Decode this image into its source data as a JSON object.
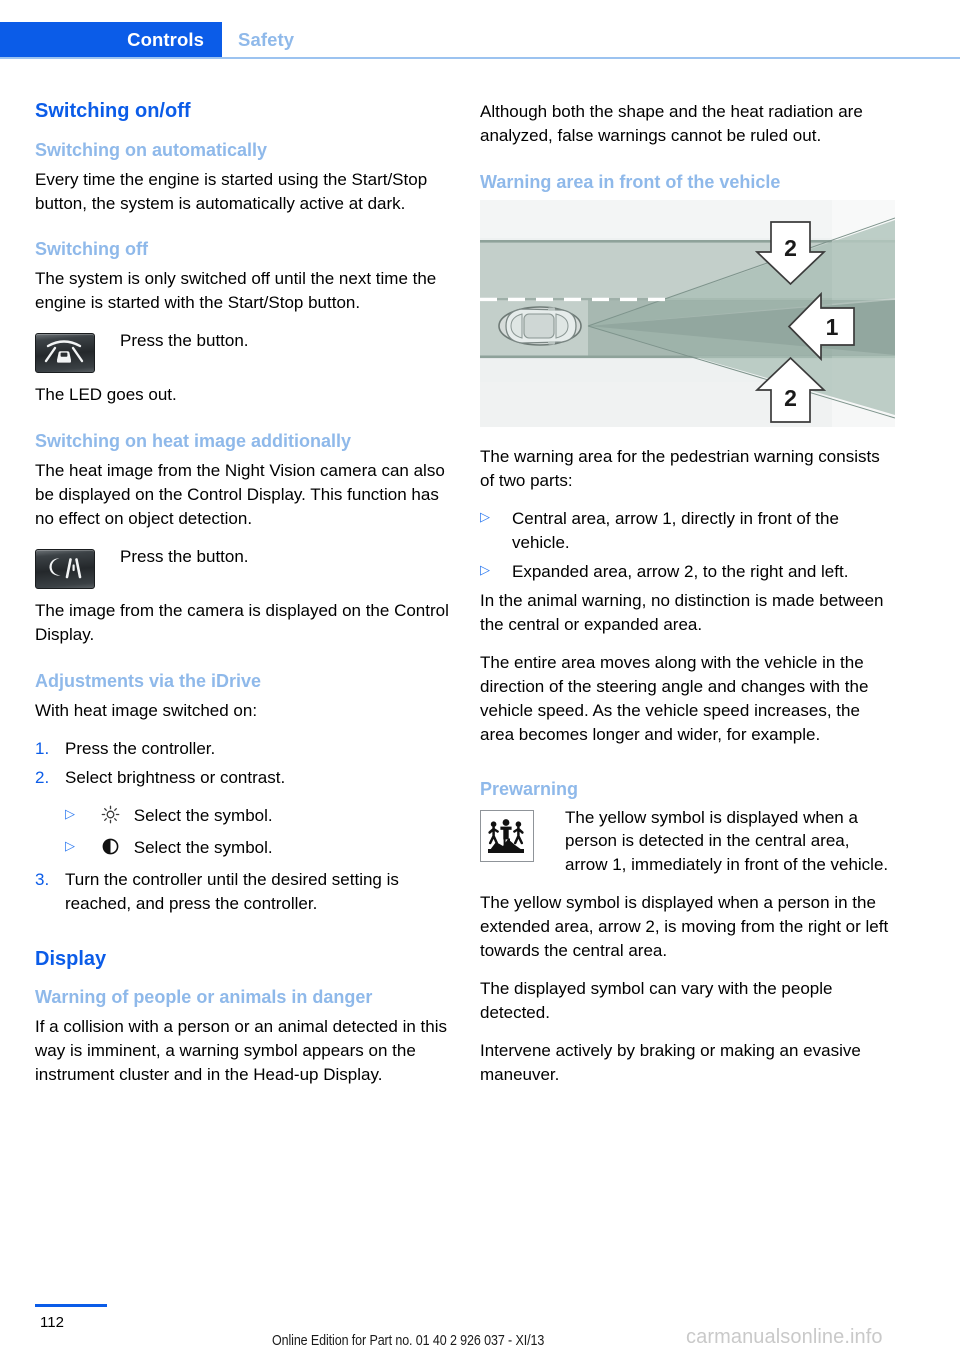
{
  "header": {
    "active_tab": "Controls",
    "inactive_tab": "Safety",
    "accent_color": "#0b5ce8",
    "muted_accent_color": "#8fb9ea"
  },
  "left_column": {
    "section_title": "Switching on/off",
    "sub_auto": "Switching on automatically",
    "p_auto": "Every time the engine is started using the Start/Stop button, the system is automatically active at dark.",
    "sub_off": "Switching off",
    "p_off": "The system is only switched off until the next time the engine is started with the Start/Stop button.",
    "press_button_1": "Press the button.",
    "p_led": "The LED goes out.",
    "sub_heat": "Switching on heat image additionally",
    "p_heat": "The heat image from the Night Vision camera can also be displayed on the Control Display. This function has no effect on object detection.",
    "press_button_2": "Press the button.",
    "p_camera": "The image from the camera is displayed on the Control Display.",
    "sub_idrive": "Adjustments via the iDrive",
    "p_idrive_intro": "With heat image switched on:",
    "steps": [
      {
        "num": "1.",
        "text": "Press the controller."
      },
      {
        "num": "2.",
        "text": "Select brightness or contrast."
      },
      {
        "num": "3.",
        "text": "Turn the controller until the desired setting is reached, and press the controller."
      }
    ],
    "sub_steps": [
      {
        "marker": "▷",
        "symbol": "brightness-icon",
        "text": "Select the symbol."
      },
      {
        "marker": "▷",
        "symbol": "contrast-icon",
        "text": "Select the symbol."
      }
    ],
    "section_title_2": "Display",
    "sub_warning": "Warning of people or animals in danger",
    "p_warning": "If a collision with a person or an animal detected in this way is imminent, a warning symbol appears on the instrument cluster and in the Head-up Display."
  },
  "right_column": {
    "p_shape": "Although both the shape and the heat radiation are analyzed, false warnings cannot be ruled out.",
    "sub_warning_area": "Warning area in front of the vehicle",
    "figure": {
      "name": "warning-area-diagram",
      "arrow_labels": [
        "2",
        "1",
        "2"
      ]
    },
    "p_parts": "The warning area for the pedestrian warning consists of two parts:",
    "parts": [
      {
        "marker": "▷",
        "text": "Central area, arrow 1, directly in front of the vehicle."
      },
      {
        "marker": "▷",
        "text": "Expanded area, arrow 2, to the right and left."
      }
    ],
    "p_animal": "In the animal warning, no distinction is made between the central or expanded area.",
    "p_moves": "The entire area moves along with the vehicle in the direction of the steering angle and changes with the vehicle speed. As the vehicle speed increases, the area becomes longer and wider, for example.",
    "sub_prewarning": "Prewarning",
    "p_prewarn_icon": "The yellow symbol is displayed when a person is detected in the central area, arrow 1, immediately in front of the vehicle.",
    "p_prewarn_2": "The yellow symbol is displayed when a person in the extended area, arrow 2, is moving from the right or left towards the central area.",
    "p_prewarn_3": "The displayed symbol can vary with the people detected.",
    "p_prewarn_4": "Intervene actively by braking or making an evasive maneuver."
  },
  "footer": {
    "page_number": "112",
    "edition": "Online Edition for Part no. 01 40 2 926 037 - XI/13",
    "watermark": "carmanualsonline.info"
  }
}
